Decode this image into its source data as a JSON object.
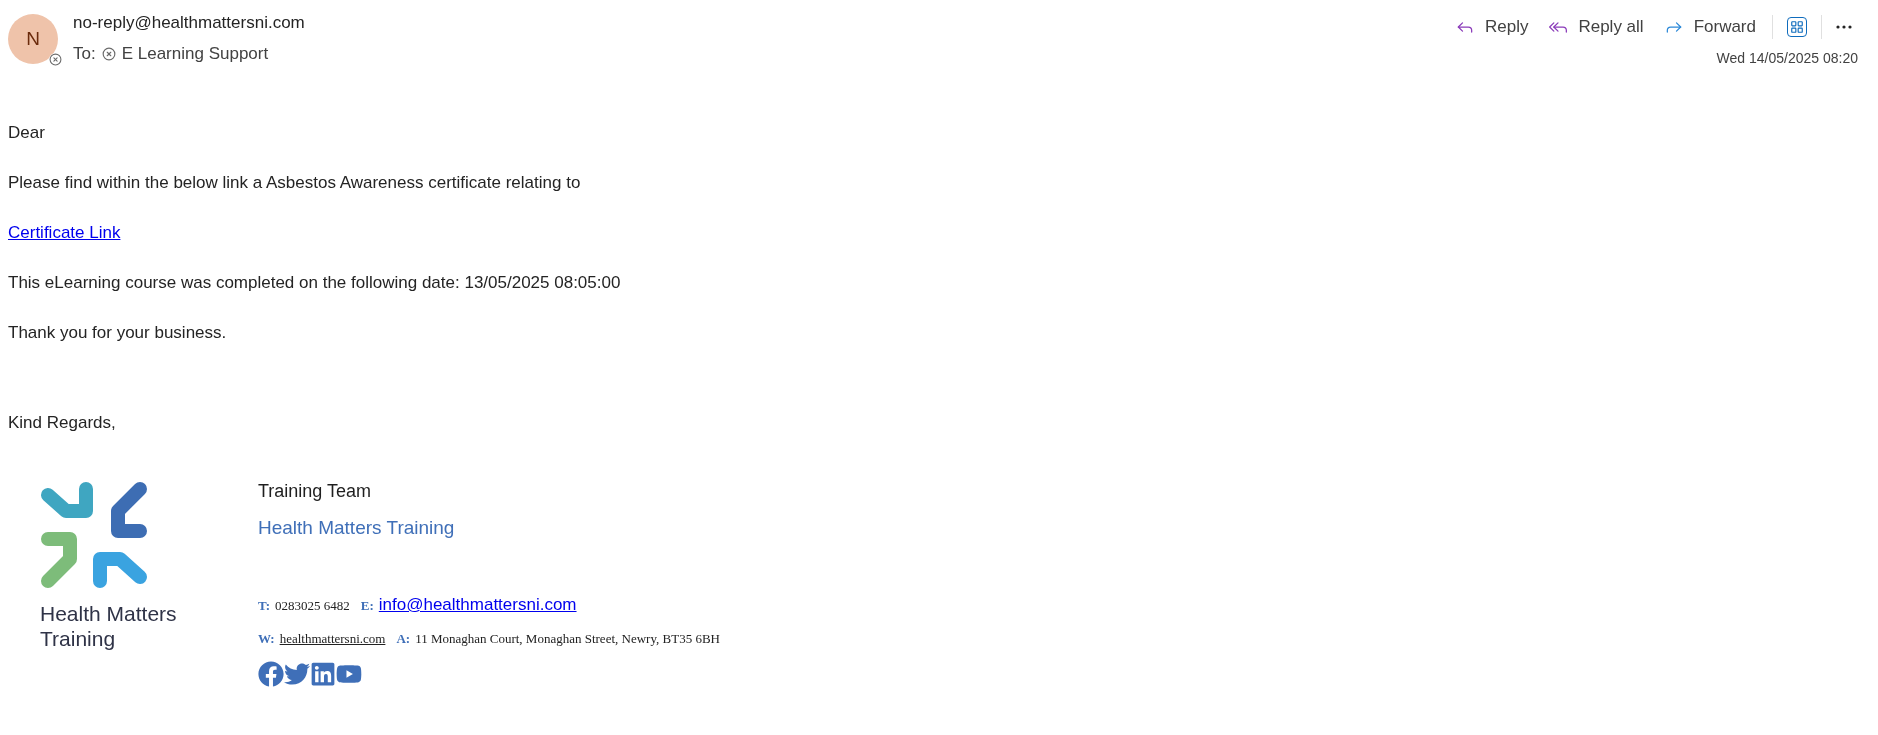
{
  "header": {
    "avatar_initial": "N",
    "sender": "no-reply@healthmattersni.com",
    "to_label": "To:",
    "recipient": "E Learning Support",
    "date": "Wed 14/05/2025 08:20"
  },
  "actions": [
    {
      "kind": "reply",
      "label": "Reply"
    },
    {
      "kind": "replyall",
      "label": "Reply all"
    },
    {
      "kind": "forward",
      "label": "Forward"
    },
    {
      "kind": "apps"
    },
    {
      "kind": "more"
    }
  ],
  "body": [
    {
      "kind": "text",
      "text": "Dear"
    },
    {
      "kind": "text",
      "text": "Please find within the below link a Asbestos Awareness certificate relating to"
    },
    {
      "kind": "link",
      "text": "Certificate Link"
    },
    {
      "kind": "text",
      "text": "This eLearning course was completed on the following date: 13/05/2025 08:05:00"
    },
    {
      "kind": "text",
      "text": "Thank you for your business."
    },
    {
      "kind": "gap"
    },
    {
      "kind": "text",
      "text": "Kind Regards,"
    }
  ],
  "signature": {
    "logo_text_1": "Health Matters",
    "logo_text_2": "Training",
    "team": "Training Team",
    "company": "Health Matters Training",
    "phone_label": "T:",
    "phone": "0283025 6482",
    "email_label": "E:",
    "email": "info@healthmattersni.com",
    "web_label": "W:",
    "web": "healthmattersni.com",
    "address_label": "A:",
    "address": "11 Monaghan Court, Monaghan Street, Newry, BT35 6BH",
    "social": [
      {
        "kind": "facebook"
      },
      {
        "kind": "twitter"
      },
      {
        "kind": "linkedin"
      },
      {
        "kind": "youtube"
      }
    ]
  }
}
